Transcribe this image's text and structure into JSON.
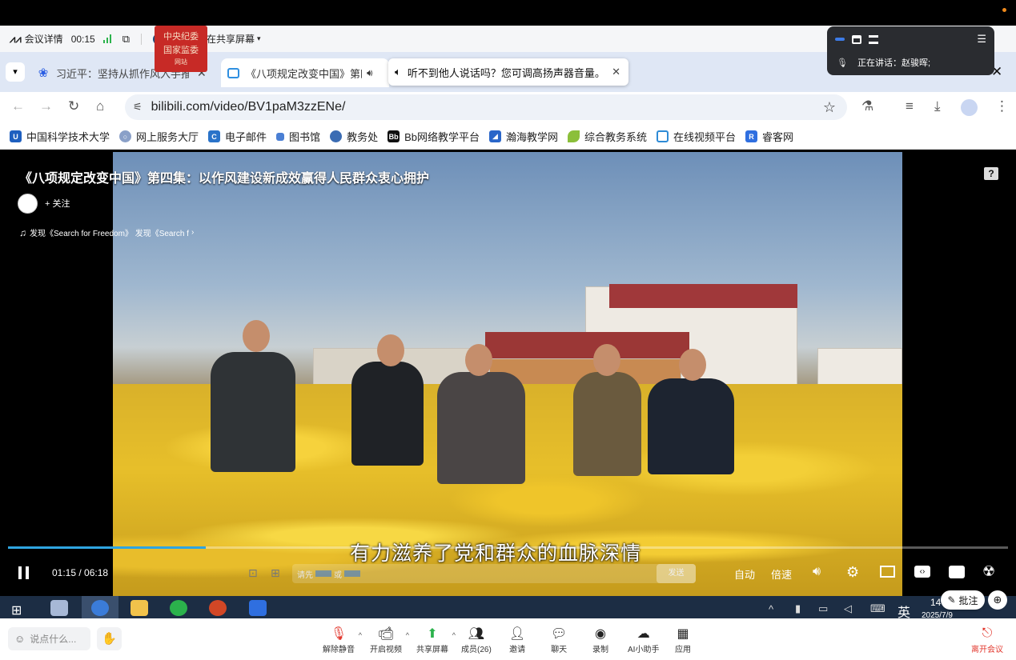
{
  "meeting_bar": {
    "details_label": "会议详情",
    "elapsed": "00:15",
    "sharing_label": "赵骏晖正在共享屏幕"
  },
  "speaker_panel": {
    "speaking_label": "正在讲话：赵骏晖;"
  },
  "tabs": [
    {
      "title": "习近平：坚持从抓作风入手推进",
      "icon": "baidu-paw-icon"
    },
    {
      "title": "《八项规定改变中国》第四",
      "icon": "bilibili-tv-icon"
    }
  ],
  "notice": {
    "text": "听不到他人说话吗？您可调高扬声器音量。"
  },
  "address": {
    "url": "bilibili.com/video/BV1paM3zzENe/"
  },
  "bookmarks": [
    {
      "label": "中国科学技术大学",
      "color": "#1e5fbf"
    },
    {
      "label": "网上服务大厅",
      "color": "#8aa0c8"
    },
    {
      "label": "电子邮件",
      "color": "#2a73c9"
    },
    {
      "label": "图书馆",
      "color": "#4a7fd4"
    },
    {
      "label": "教务处",
      "color": "#3b6cb3"
    },
    {
      "label": "Bb网络教学平台",
      "color": "#111111"
    },
    {
      "label": "瀚海教学网",
      "color": "#2a66c9"
    },
    {
      "label": "综合教务系统",
      "color": "#8bbf3a"
    },
    {
      "label": "在线视频平台",
      "color": "#2e8bd6"
    },
    {
      "label": "睿客网",
      "color": "#2f6fe0"
    }
  ],
  "video": {
    "title": "《八项规定改变中国》第四集：以作风建设新成效赢得人民群众衷心拥护",
    "follow_label": "+ 关注",
    "music_line": "发现《Search for Freedom》 发现《Search f",
    "seal_line1": "中央纪委",
    "seal_line2": "国家监委",
    "seal_line3": "网站",
    "subtitle": "有力滋养了党和群众的血脉深情",
    "time_display": "01:15 / 06:18",
    "progress": 0.198,
    "danmaku_placeholder_prefix": "请先",
    "danmaku_placeholder_mid": "或",
    "send_label": "发送",
    "auto_label": "自动",
    "speed_label": "倍速"
  },
  "taskbar": {
    "ime_label": "英",
    "clock_time": "14",
    "clock_date": "2025/7/9"
  },
  "overlay_buttons": {
    "annotate_label": "批注"
  },
  "toolbar": {
    "say_placeholder": "说点什么...",
    "unmute": "解除静音",
    "start_video": "开启视频",
    "share_screen": "共享屏幕",
    "members": "成员(26)",
    "invite": "邀请",
    "chat": "聊天",
    "record": "录制",
    "ai_assistant": "AI小助手",
    "apps": "应用",
    "leave": "离开会议"
  }
}
